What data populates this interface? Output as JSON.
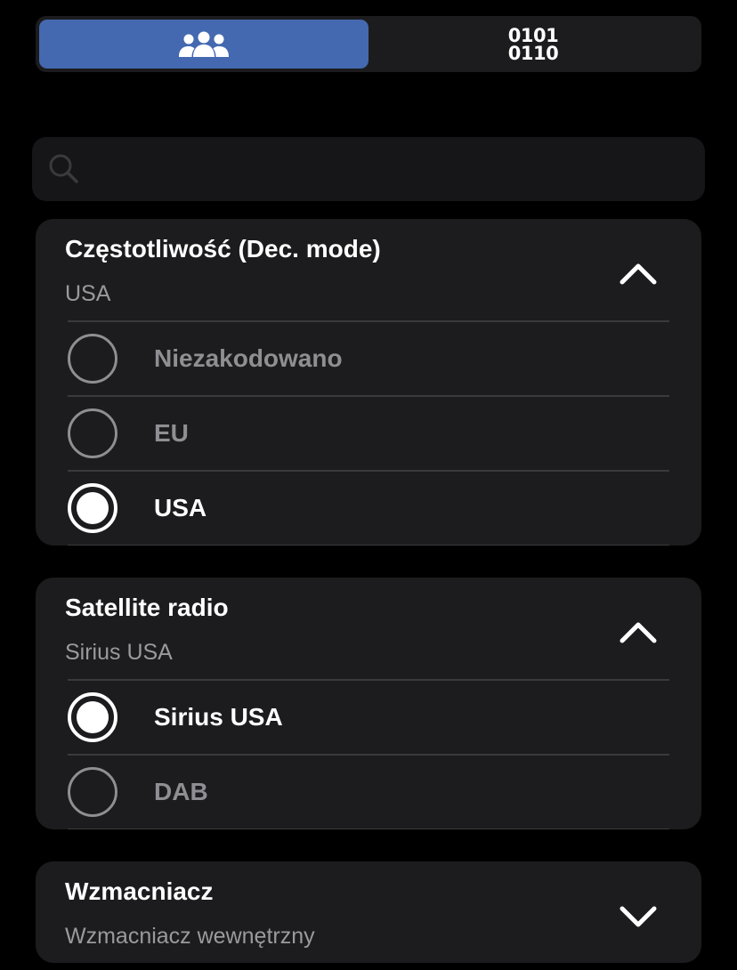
{
  "tabs": [
    {
      "icon": "users-icon",
      "active": true
    },
    {
      "icon": "binary-icon",
      "label_line1": "0101",
      "label_line2": "0110",
      "active": false
    }
  ],
  "search": {
    "placeholder": "",
    "value": ""
  },
  "sections": [
    {
      "title": "Częstotliwość (Dec. mode)",
      "value": "USA",
      "expanded": true,
      "options": [
        {
          "label": "Niezakodowano",
          "selected": false
        },
        {
          "label": "EU",
          "selected": false
        },
        {
          "label": "USA",
          "selected": true
        }
      ]
    },
    {
      "title": "Satellite radio",
      "value": "Sirius USA",
      "expanded": true,
      "options": [
        {
          "label": "Sirius USA",
          "selected": true
        },
        {
          "label": "DAB",
          "selected": false
        }
      ]
    },
    {
      "title": "Wzmacniacz",
      "value": "Wzmacniacz wewnętrzny",
      "expanded": false
    }
  ],
  "colors": {
    "accent": "#4569b0",
    "background": "#000000",
    "card": "#1c1c1e",
    "secondary_text": "#9a9a9e",
    "unselected": "#8e8e93"
  }
}
